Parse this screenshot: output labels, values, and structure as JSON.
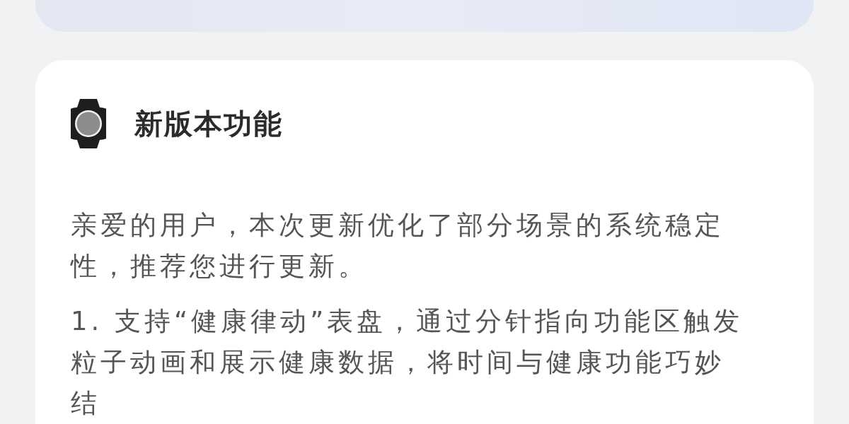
{
  "whats_new": {
    "title": "新版本功能",
    "paragraphs": [
      "亲爱的用户，本次更新优化了部分场景的系统稳定性，推荐您进行更新。",
      "1. 支持“健康律动”表盘，通过分针指向功能区触发粒子动画和展示健康数据，将时间与健康功能巧妙结"
    ]
  }
}
